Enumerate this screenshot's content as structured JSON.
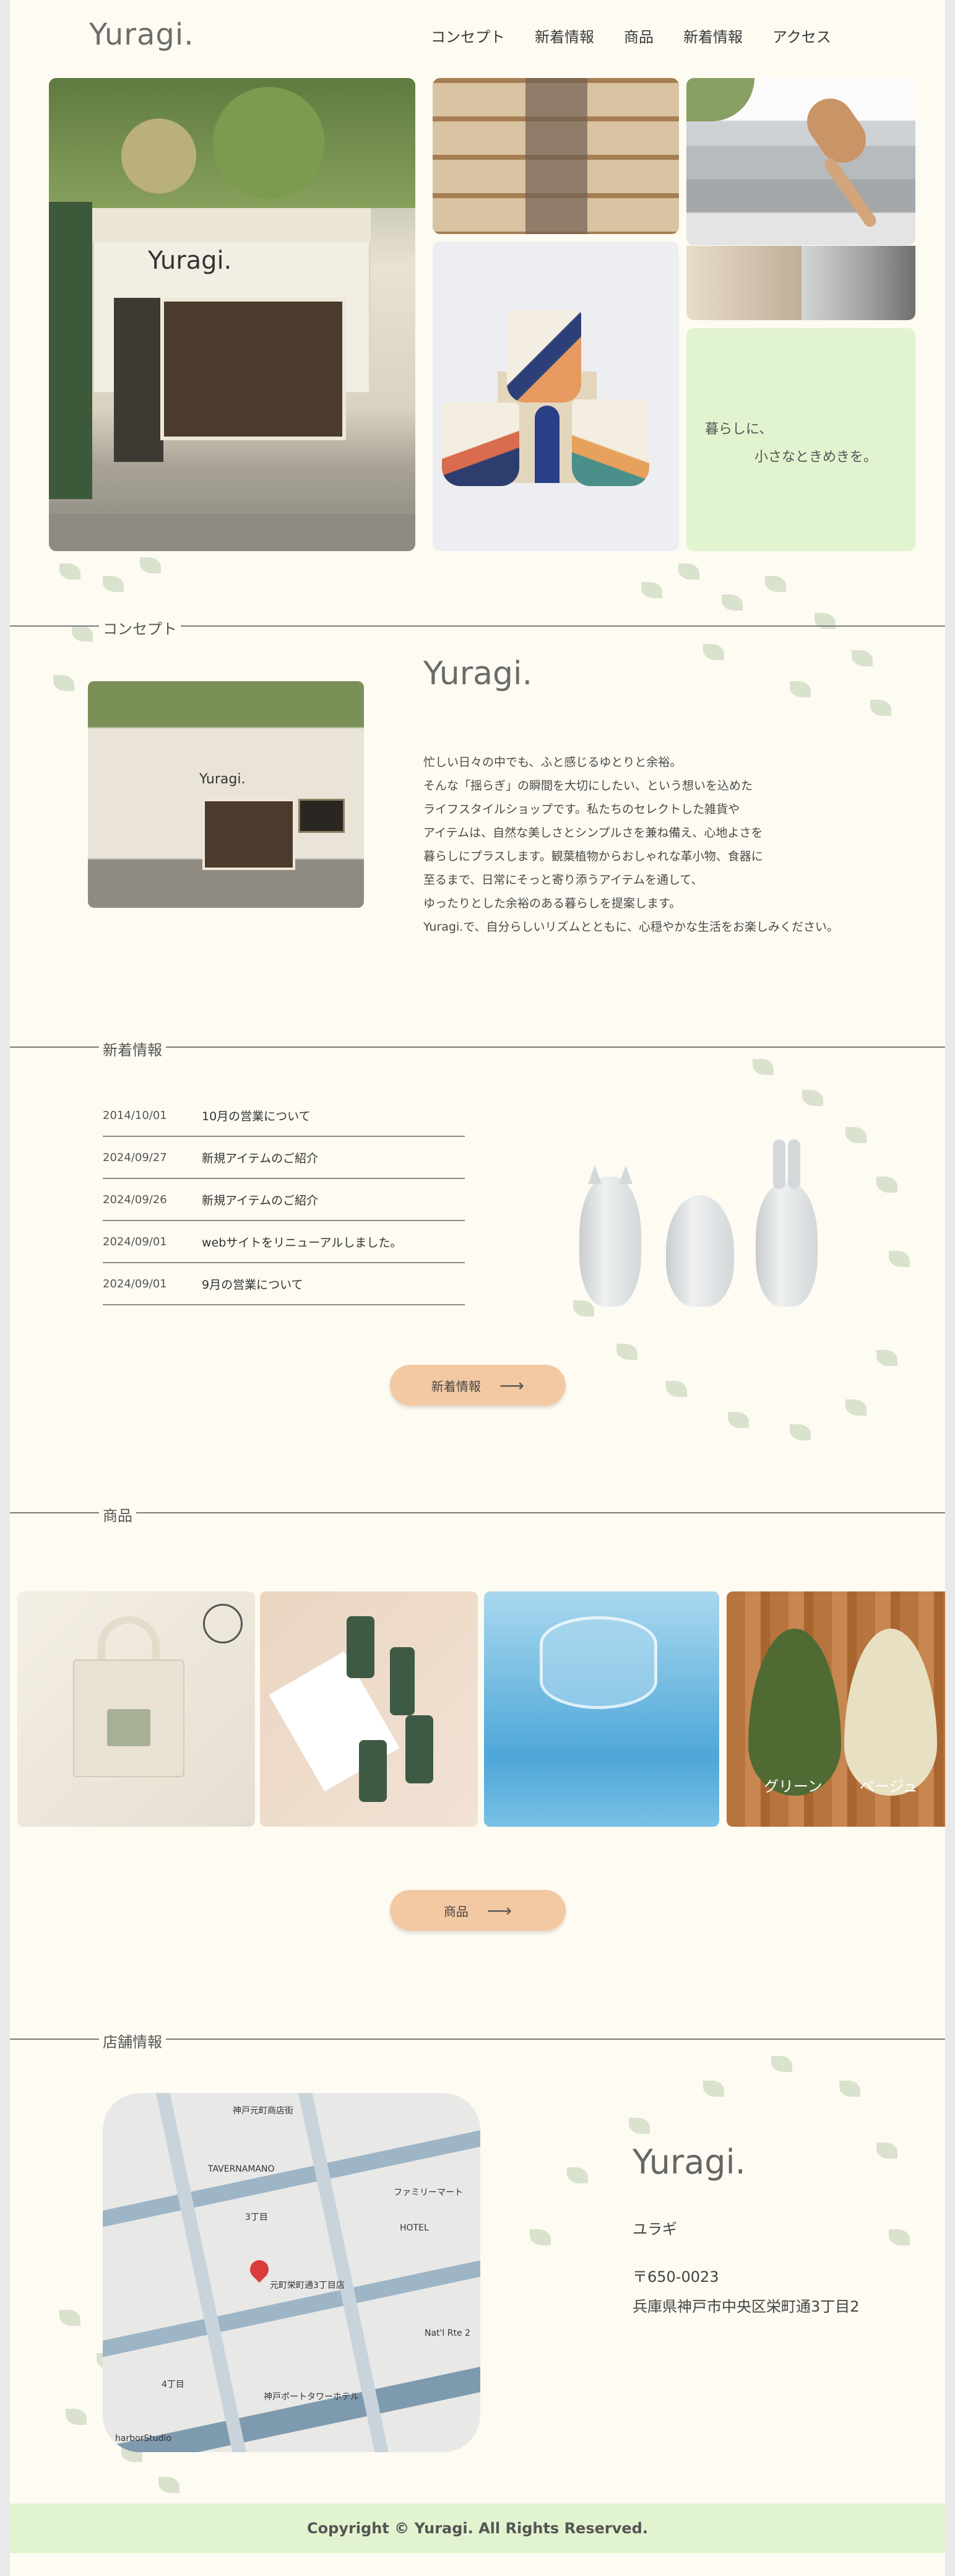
{
  "header": {
    "logo": "Yuragi.",
    "nav": [
      "コンセプト",
      "新着情報",
      "商品",
      "新着情報",
      "アクセス"
    ]
  },
  "hero": {
    "shop_sign": "Yuragi.",
    "catch_line1": "暮らしに、",
    "catch_line2": "小さなときめきを。"
  },
  "concept": {
    "section_label": "コンセプト",
    "image_sign": "Yuragi.",
    "logo": "Yuragi.",
    "text": [
      "忙しい日々の中でも、ふと感じるゆとりと余裕。",
      "そんな「揺らぎ」の瞬間を大切にしたい、という想いを込めた",
      "ライフスタイルショップです。私たちのセレクトした雑貨や",
      "アイテムは、自然な美しさとシンプルさを兼ね備え、心地よさを",
      "暮らしにプラスします。観葉植物からおしゃれな革小物、食器に",
      "至るまで、日常にそっと寄り添うアイテムを通して、",
      "ゆったりとした余裕のある暮らしを提案します。",
      "Yuragi.で、自分らしいリズムとともに、心穏やかな生活をお楽しみください。"
    ]
  },
  "news": {
    "section_label": "新着情報",
    "items": [
      {
        "date": "2014/10/01",
        "title": "10月の営業について"
      },
      {
        "date": "2024/09/27",
        "title": "新規アイテムのご紹介"
      },
      {
        "date": "2024/09/26",
        "title": "新規アイテムのご紹介"
      },
      {
        "date": "2024/09/01",
        "title": "webサイトをリニューアルしました。"
      },
      {
        "date": "2024/09/01",
        "title": "9月の営業について"
      }
    ],
    "button_label": "新着情報",
    "button_arrow": "⟶"
  },
  "products": {
    "section_label": "商品",
    "leaf_labels": [
      "グリーン",
      "ベージュ"
    ],
    "button_label": "商品",
    "button_arrow": "⟶"
  },
  "store": {
    "section_label": "店舗情報",
    "logo": "Yuragi.",
    "kana": "ユラギ",
    "zip": "〒650-0023",
    "address": "兵庫県神戸市中央区栄町通3丁目2",
    "map_labels": [
      "神戸元町商店街",
      "TAVERNAMANO",
      "ファミリーマート",
      "HOTEL",
      "3丁目",
      "元町栄町通3丁目店",
      "Nat'l Rte 2",
      "神戸ポートタワーホテル",
      "4丁目",
      "harborStudio"
    ]
  },
  "footer": {
    "copyright": "Copyright © Yuragi. All Rights Reserved."
  },
  "colors": {
    "page_bg": "#fdfbf2",
    "accent_green": "#e2f3cf",
    "button": "#f3c9a3"
  }
}
